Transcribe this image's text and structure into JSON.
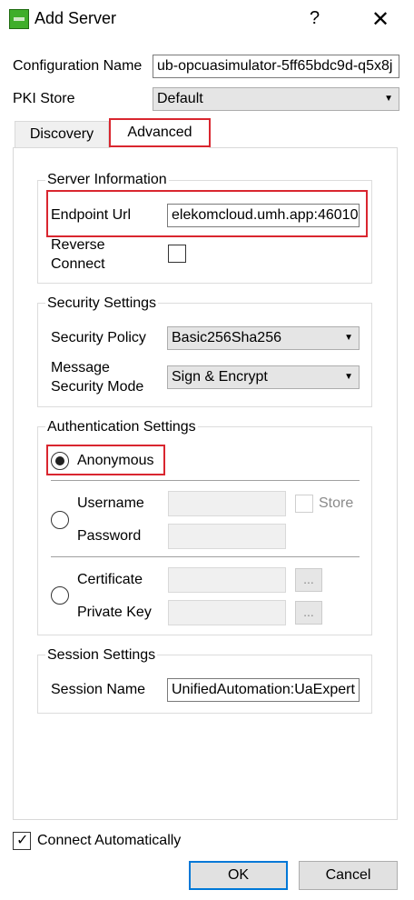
{
  "window": {
    "title": "Add Server",
    "help": "?",
    "close": "✕"
  },
  "form": {
    "configuration_name_label": "Configuration Name",
    "configuration_name_value": "ub-opcuasimulator-5ff65bdc9d-q5x8j",
    "pki_store_label": "PKI Store",
    "pki_store_value": "Default"
  },
  "tabs": [
    {
      "label": "Discovery"
    },
    {
      "label": "Advanced"
    }
  ],
  "server_information": {
    "title": "Server Information",
    "endpoint_url_label": "Endpoint Url",
    "endpoint_url_value": "elekomcloud.umh.app:46010",
    "reverse_connect_label_line1": "Reverse",
    "reverse_connect_label_line2": "Connect"
  },
  "security_settings": {
    "title": "Security Settings",
    "security_policy_label": "Security Policy",
    "security_policy_value": "Basic256Sha256",
    "message_mode_label_line1": "Message",
    "message_mode_label_line2": "Security Mode",
    "message_mode_value": "Sign & Encrypt"
  },
  "authentication_settings": {
    "title": "Authentication Settings",
    "anonymous_label": "Anonymous",
    "username_label": "Username",
    "password_label": "Password",
    "store_label": "Store",
    "certificate_label": "Certificate",
    "private_key_label": "Private Key",
    "browse_label": "..."
  },
  "session_settings": {
    "title": "Session Settings",
    "session_name_label": "Session Name",
    "session_name_value": "UnifiedAutomation:UaExpert"
  },
  "footer": {
    "connect_automatically_label": "Connect Automatically",
    "ok_label": "OK",
    "cancel_label": "Cancel"
  },
  "colors": {
    "highlight": "#d9262f",
    "default_button_border": "#0078d7"
  }
}
